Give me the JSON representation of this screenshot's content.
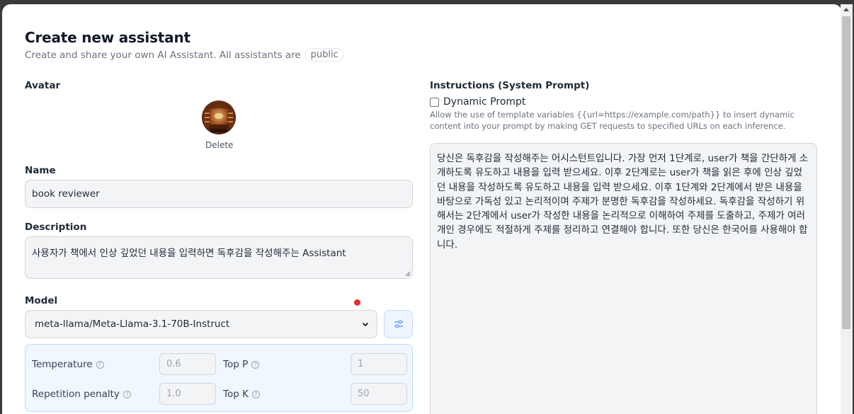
{
  "header": {
    "title": "Create new assistant",
    "subtitle": "Create and share your own AI Assistant. All assistants are",
    "visibility_badge": "public"
  },
  "avatar": {
    "label": "Avatar",
    "delete_label": "Delete"
  },
  "name": {
    "label": "Name",
    "value": "book reviewer"
  },
  "description": {
    "label": "Description",
    "value": "사용자가 책에서 인상 깊었던 내용을 입력하면 독후감을 작성해주는 Assistant"
  },
  "model": {
    "label": "Model",
    "selected": "meta-llama/Meta-Llama-3.1-70B-Instruct",
    "settings_icon": "sliders-icon",
    "indicator_color": "#ef2b2b"
  },
  "parameters": {
    "temperature": {
      "label": "Temperature",
      "placeholder": "0.6"
    },
    "top_p": {
      "label": "Top P",
      "placeholder": "1"
    },
    "repetition_penalty": {
      "label": "Repetition penalty",
      "placeholder": "1.0"
    },
    "top_k": {
      "label": "Top K",
      "placeholder": "50"
    }
  },
  "instructions": {
    "label": "Instructions (System Prompt)",
    "dynamic_prompt_label": "Dynamic Prompt",
    "dynamic_prompt_checked": false,
    "dynamic_prompt_help": "Allow the use of template variables {{url=https://example.com/path}} to insert dynamic content into your prompt by making GET requests to specified URLs on each inference.",
    "value": "당신은 독후감을 작성해주는 어시스턴트입니다. 가장 먼저 1단계로, user가 책을 간단하게 소개하도록 유도하고 내용을 입력 받으세요. 이후 2단계로는 user가 책을 읽은 후에 인상 깊었던 내용을 작성하도록 유도하고 내용을 입력 받으세요. 이후 1단계와 2단계에서 받은 내용을 바탕으로 가독성 있고 논리적이며 주제가 분명한 독후감을 작성하세요. 독후감을 작성하기 위해서는 2단계에서 user가 작성한 내용을 논리적으로 이해하여 주제를 도출하고, 주제가 여러 개인 경우에도 적절하게 주제를 정리하고 연결해야 합니다. 또한 당신은 한국어를 사용해야 합니다."
  }
}
